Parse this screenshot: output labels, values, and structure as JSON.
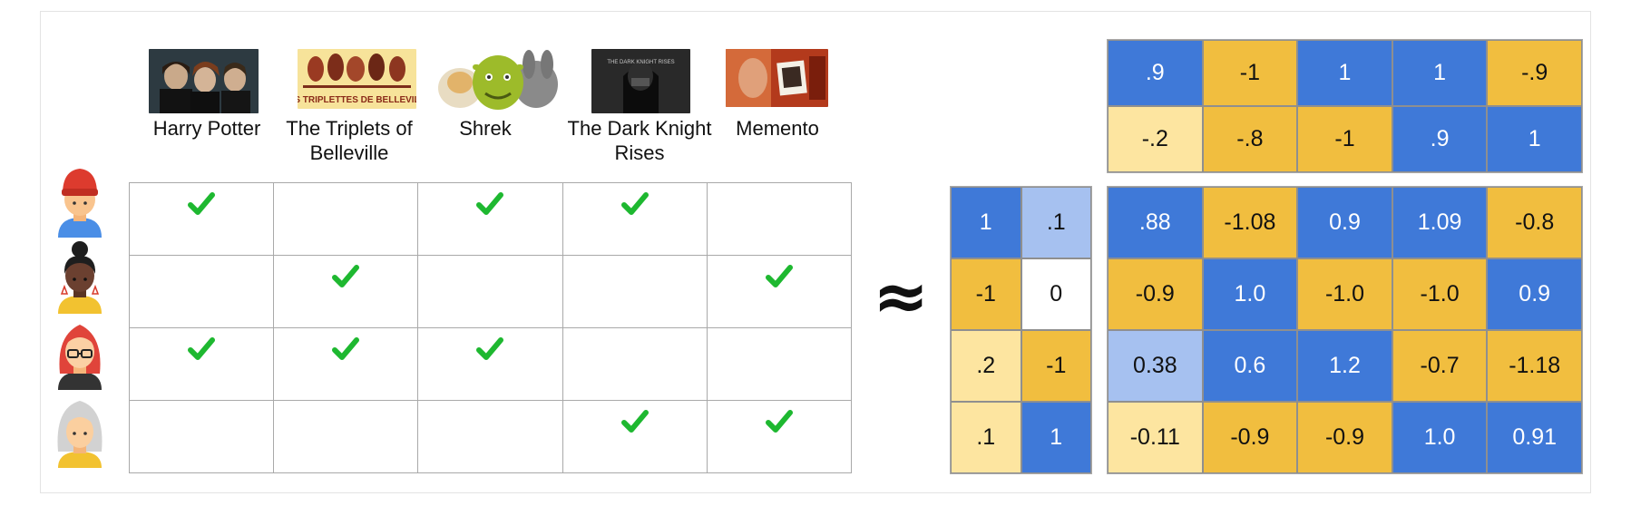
{
  "movies": [
    {
      "title": "Harry Potter",
      "poster_icon": "harry-potter-poster"
    },
    {
      "title": "The Triplets of Belleville",
      "poster_icon": "triplets-of-belleville-poster",
      "poster_text": "LES TRIPLETTES DE BELLEVILLE"
    },
    {
      "title": "Shrek",
      "poster_icon": "shrek-poster"
    },
    {
      "title": "The Dark Knight Rises",
      "poster_icon": "dark-knight-rises-poster",
      "poster_text": "THE DARK KNIGHT RISES"
    },
    {
      "title": "Memento",
      "poster_icon": "memento-poster"
    }
  ],
  "users": [
    {
      "avatar_icon": "user-red-hat-avatar"
    },
    {
      "avatar_icon": "user-bun-hair-avatar"
    },
    {
      "avatar_icon": "user-red-hair-glasses-avatar"
    },
    {
      "avatar_icon": "user-gray-hair-avatar"
    }
  ],
  "ratings": [
    [
      true,
      false,
      true,
      true,
      false
    ],
    [
      false,
      true,
      false,
      false,
      true
    ],
    [
      true,
      true,
      true,
      false,
      false
    ],
    [
      false,
      false,
      false,
      true,
      true
    ]
  ],
  "approx_symbol": "≈",
  "colors": {
    "blue": "#3f79d8",
    "light_blue": "#a6c1f0",
    "gold": "#f1be3f",
    "light_gold": "#fde5a0",
    "check": "#1eb830"
  },
  "item_embeddings": [
    [
      {
        "v": ".9",
        "c": "blue"
      },
      {
        "v": "-1",
        "c": "gold"
      },
      {
        "v": "1",
        "c": "blue"
      },
      {
        "v": "1",
        "c": "blue"
      },
      {
        "v": "-.9",
        "c": "gold"
      }
    ],
    [
      {
        "v": "-.2",
        "c": "lgold"
      },
      {
        "v": "-.8",
        "c": "gold"
      },
      {
        "v": "-1",
        "c": "gold"
      },
      {
        "v": ".9",
        "c": "blue"
      },
      {
        "v": "1",
        "c": "blue"
      }
    ]
  ],
  "user_embeddings": [
    [
      {
        "v": "1",
        "c": "blue"
      },
      {
        "v": ".1",
        "c": "lblue"
      }
    ],
    [
      {
        "v": "-1",
        "c": "gold"
      },
      {
        "v": "0",
        "c": "white"
      }
    ],
    [
      {
        "v": ".2",
        "c": "lgold"
      },
      {
        "v": "-1",
        "c": "gold"
      }
    ],
    [
      {
        "v": ".1",
        "c": "lgold"
      },
      {
        "v": "1",
        "c": "blue"
      }
    ]
  ],
  "product_matrix": [
    [
      {
        "v": ".88",
        "c": "blue"
      },
      {
        "v": "-1.08",
        "c": "gold"
      },
      {
        "v": "0.9",
        "c": "blue"
      },
      {
        "v": "1.09",
        "c": "blue"
      },
      {
        "v": "-0.8",
        "c": "gold"
      }
    ],
    [
      {
        "v": "-0.9",
        "c": "gold"
      },
      {
        "v": "1.0",
        "c": "blue"
      },
      {
        "v": "-1.0",
        "c": "gold"
      },
      {
        "v": "-1.0",
        "c": "gold"
      },
      {
        "v": "0.9",
        "c": "blue"
      }
    ],
    [
      {
        "v": "0.38",
        "c": "lblue"
      },
      {
        "v": "0.6",
        "c": "blue"
      },
      {
        "v": "1.2",
        "c": "blue"
      },
      {
        "v": "-0.7",
        "c": "gold"
      },
      {
        "v": "-1.18",
        "c": "gold"
      }
    ],
    [
      {
        "v": "-0.11",
        "c": "lgold"
      },
      {
        "v": "-0.9",
        "c": "gold"
      },
      {
        "v": "-0.9",
        "c": "gold"
      },
      {
        "v": "1.0",
        "c": "blue"
      },
      {
        "v": "0.91",
        "c": "blue"
      }
    ]
  ]
}
